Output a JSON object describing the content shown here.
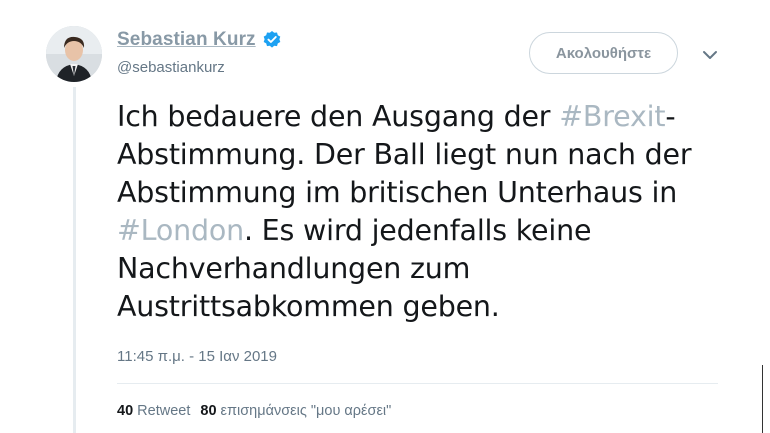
{
  "author": {
    "display_name": "Sebastian Kurz",
    "handle": "@sebastiankurz",
    "verified": true,
    "avatar_icon": "profile-photo"
  },
  "actions": {
    "follow_label": "Ακολουθήστε",
    "menu_icon": "chevron-down-icon"
  },
  "tweet": {
    "line1_pre": "Ich bedauere den Ausgang der ",
    "line1_hashtag": "#Brexit",
    "line1_post": "-",
    "line2": "Abstimmung. Der Ball liegt nun nach der",
    "line3": "Abstimmung im britischen Unterhaus in",
    "line4_hashtag": "#London",
    "line4_post": ". Es wird jedenfalls keine",
    "line5": "Nachverhandlungen zum",
    "line6": "Austrittsabkommen geben."
  },
  "meta": {
    "timestamp": "11:45 π.μ. - 15 Ιαν 2019"
  },
  "stats": {
    "retweets_count": "40",
    "retweets_label": "Retweet",
    "likes_count": "80",
    "likes_label": "επισημάνσεις \"μου αρέσει\""
  },
  "colors": {
    "hashtag": "#aab8c2",
    "name": "#8899a6",
    "verified": "#1da1f2",
    "secondary_text": "#657786"
  }
}
